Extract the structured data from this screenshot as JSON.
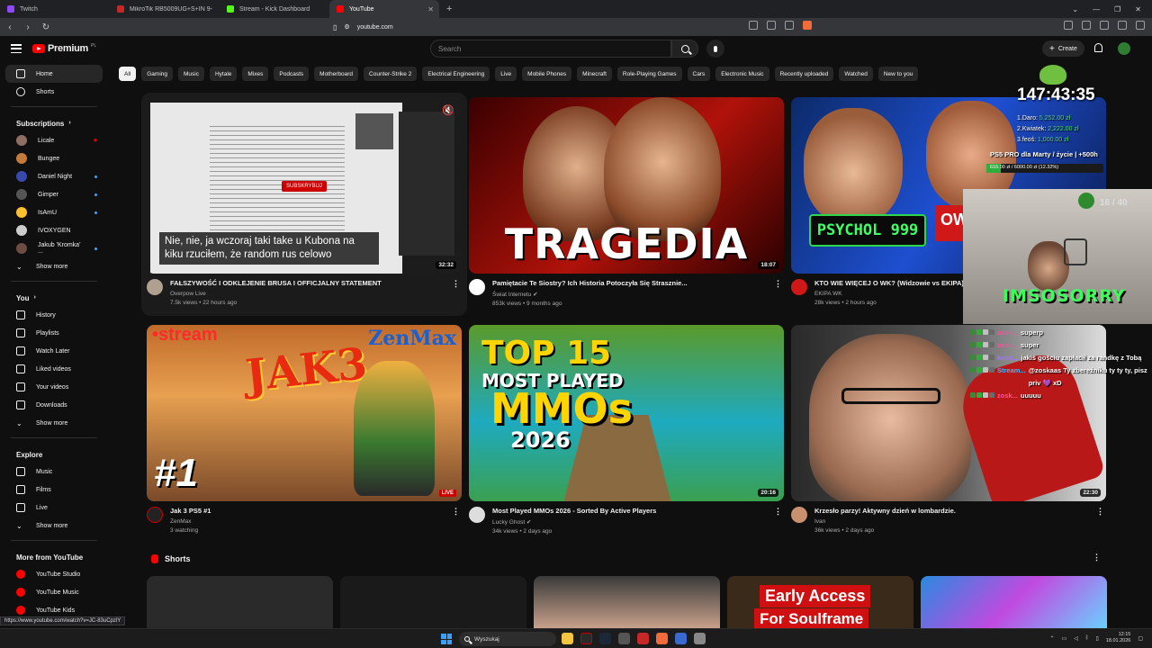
{
  "browser": {
    "tabs": [
      {
        "label": "Twitch",
        "color": "#9146ff"
      },
      {
        "label": "MikroTik RB5009UG+S+IN 9-Port Ro",
        "color": "#c62828"
      },
      {
        "label": "Stream - Kick Dashboard",
        "color": "#53fc18"
      },
      {
        "label": "YouTube",
        "color": "#ff0000"
      }
    ],
    "new_tab": "+",
    "window_controls": [
      "⌄",
      "—",
      "❐",
      "✕"
    ],
    "url": "youtube.com",
    "status_url": "https://www.youtube.com/watch?v=JC-83uCpzlY"
  },
  "header": {
    "logo": "Premium",
    "logo_cc": "PL",
    "search_placeholder": "Search",
    "create_label": "Create"
  },
  "chips": [
    "All",
    "Gaming",
    "Music",
    "Hytale",
    "Mixes",
    "Podcasts",
    "Motherboard",
    "Counter-Strike 2",
    "Electrical Engineering",
    "Live",
    "Mobile Phones",
    "Minecraft",
    "Role-Playing Games",
    "Cars",
    "Electronic Music",
    "Recently uploaded",
    "Watched",
    "New to you"
  ],
  "sidebar": {
    "main": [
      {
        "label": "Home",
        "icon": "home-icon"
      },
      {
        "label": "Shorts",
        "icon": "shorts-icon"
      }
    ],
    "subscriptions_title": "Subscriptions",
    "subscriptions": [
      {
        "label": "Licale",
        "color": "#8d6e63",
        "status": "live"
      },
      {
        "label": "Bungee",
        "color": "#c47a3a",
        "status": ""
      },
      {
        "label": "Daniel Night",
        "color": "#3949ab",
        "status": "new"
      },
      {
        "label": "Gimper",
        "color": "#555555",
        "status": "new"
      },
      {
        "label": "IsAmU",
        "color": "#fbc02d",
        "status": "new"
      },
      {
        "label": "IVOXYGEN",
        "color": "#cccccc",
        "status": ""
      },
      {
        "label": "Jakub 'Kromka' ...",
        "color": "#6d4c41",
        "status": "new"
      }
    ],
    "show_more": "Show more",
    "you_title": "You",
    "you": [
      {
        "label": "History",
        "icon": "history-icon"
      },
      {
        "label": "Playlists",
        "icon": "playlists-icon"
      },
      {
        "label": "Watch Later",
        "icon": "watch-later-icon"
      },
      {
        "label": "Liked videos",
        "icon": "like-icon"
      },
      {
        "label": "Your videos",
        "icon": "your-videos-icon"
      },
      {
        "label": "Downloads",
        "icon": "download-icon"
      }
    ],
    "explore_title": "Explore",
    "explore": [
      {
        "label": "Music",
        "icon": "music-icon"
      },
      {
        "label": "Films",
        "icon": "films-icon"
      },
      {
        "label": "Live",
        "icon": "live-icon"
      }
    ],
    "more_title": "More from YouTube",
    "more": [
      {
        "label": "YouTube Studio"
      },
      {
        "label": "YouTube Music"
      },
      {
        "label": "YouTube Kids"
      }
    ]
  },
  "videos": [
    {
      "title": "FAŁSZYWOŚĆ I ODKLEJENIE BRUSA I OFFICJALNY STATEMENT",
      "channel": "Overpow Live",
      "stats": "7.5k views • 22 hours ago",
      "duration": "32:32",
      "caption": "Nie, nie, ja wczoraj taki take u Kubona na kiku rzuciłem, że random rus celowo",
      "subscribe": "SUBSKRYBUJ",
      "avatar_color": "#b0a090"
    },
    {
      "title": "Pamiętacie Te Siostry? Ich Historia Potoczyła Się Strasznie...",
      "channel": "Świat Internetu ✔",
      "stats": "853k views • 9 months ago",
      "duration": "18:07",
      "thumb_text": "TRAGEDIA",
      "avatar_color": "#ffffff"
    },
    {
      "title": "KTO WIE WIĘCEJ O WK? (Widzowie vs EKIPA)",
      "channel": "EKIPA WK",
      "stats": "28k views • 2 hours ago",
      "duration": "",
      "thumb_text": "PSYCHOL 999",
      "thumb_text2": "OW",
      "avatar_color": "#d01818"
    },
    {
      "title": "Jak 3 PS5 #1",
      "channel": "ZenMax",
      "stats": "3 watching",
      "live": "LIVE",
      "thumb_text": "JAK3",
      "thumb_stream": "•stream",
      "thumb_zen": "ZenMax",
      "thumb_num": "#1",
      "avatar_color": "#222222"
    },
    {
      "title": "Most Played MMOs 2026 - Sorted By Active Players",
      "channel": "Lucky Ghost ✔",
      "stats": "34k views • 2 days ago",
      "duration": "20:16",
      "thumb_line1": "TOP 15",
      "thumb_line2": "MOST PLAYED",
      "thumb_line3": "MMOs",
      "thumb_line4": "2026",
      "avatar_color": "#dddddd"
    },
    {
      "title": "Krzesło parzy! Aktywny dzień w lombardzie.",
      "channel": "Ivan",
      "stats": "36k views • 2 days ago",
      "duration": "22:30",
      "avatar_color": "#c99070"
    }
  ],
  "shorts": {
    "title": "Shorts",
    "items": [
      {
        "text1": "",
        "text2": ""
      },
      {
        "text1": "",
        "text2": ""
      },
      {
        "text1": "",
        "text2": ""
      },
      {
        "text1": "Early Access",
        "text2": "For Soulframe"
      },
      {
        "text1": "",
        "text2": ""
      }
    ]
  },
  "overlay": {
    "timer": "147:43:35",
    "goals": [
      {
        "rank": "1.Daro:",
        "amount": "5,252.00 zł"
      },
      {
        "rank": "2.Kwiatek:",
        "amount": "2,222.00 zł"
      },
      {
        "rank": "3.feoś:",
        "amount": "1,000.00 zł"
      }
    ],
    "sub_goal": "PS5 PRO dla Marty / życie | +500h",
    "bar_text": "616.00 zł / 6000.00 zł (12.32%)",
    "bar_progress": 0.1232,
    "webcam_count": "16 / 40",
    "webcam_title": "IMSOSORRY",
    "chat": [
      {
        "name": "zosk...",
        "msg": "superp",
        "color": "#ff4fa0"
      },
      {
        "name": "zosk...",
        "msg": "super",
        "color": "#ff4fa0"
      },
      {
        "name": "kose...",
        "msg": "jakiś gościu zapłacił za randkę z Tobą",
        "color": "#a074ff"
      },
      {
        "name": "Stream...",
        "msg": "@zoskaas Ty zbereźniku ty ty ty, pisz priv 💜 xD",
        "color": "#3ab8ff"
      },
      {
        "name": "zosk...",
        "msg": "uuuuu",
        "color": "#ff4fa0"
      }
    ]
  },
  "taskbar": {
    "search": "Wyszukaj",
    "time": "12:15",
    "date": "18.01.2026"
  }
}
